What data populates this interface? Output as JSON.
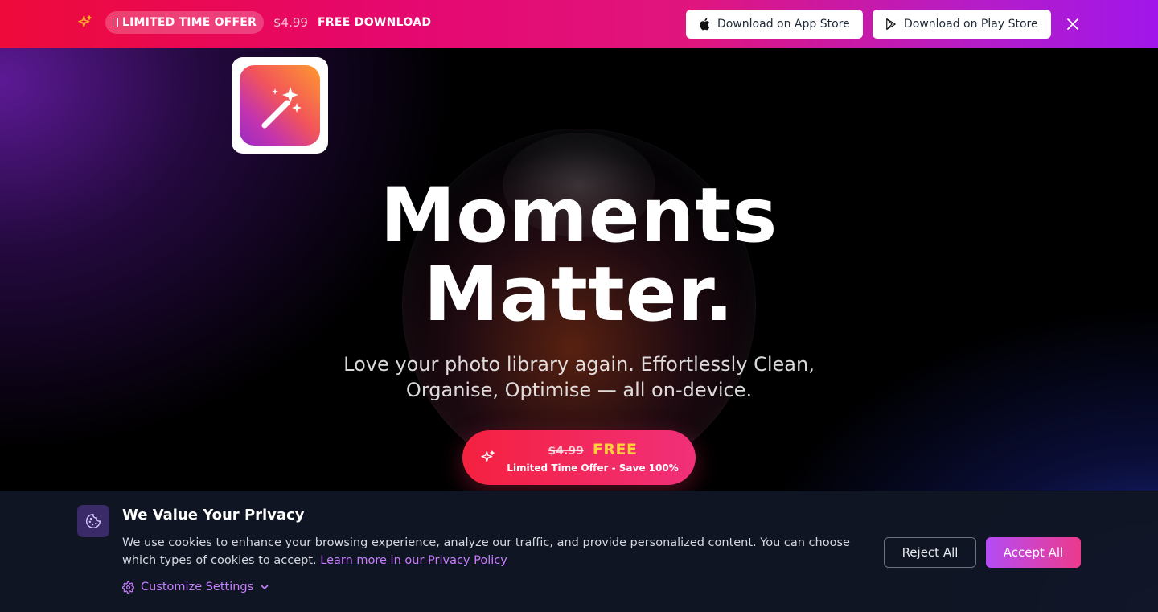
{
  "promo": {
    "badge": "LIMITED TIME OFFER",
    "old_price": "$4.99",
    "free_text": "FREE DOWNLOAD",
    "app_store_label": "Download on App Store",
    "play_store_label": "Download on Play Store",
    "icons": [
      "sparkle-icon",
      "apple-icon",
      "play-icon",
      "close-icon"
    ]
  },
  "hero": {
    "headline_line1": "Moments",
    "headline_line2": "Matter.",
    "subtitle": "Love your photo library again. Effortlessly Clean, Organise, Optimise — all on-device.",
    "app_icon": "magic-wand-icon",
    "cta": {
      "old_price": "$4.99",
      "free_label": "FREE",
      "sub_label": "Limited Time Offer - Save 100%"
    }
  },
  "cookie": {
    "title": "We Value Your Privacy",
    "text": "We use cookies to enhance your browsing experience, analyze our traffic, and provide personalized content. You can choose which types of cookies to accept.",
    "link_text": "Learn more in our Privacy Policy",
    "customize_label": "Customize Settings",
    "reject_label": "Reject All",
    "accept_label": "Accept All"
  },
  "colors": {
    "accent_pink": "#f1307a",
    "accent_purple": "#b44cf5",
    "price_yellow": "#ffd23a",
    "link_purple": "#c77dff"
  }
}
